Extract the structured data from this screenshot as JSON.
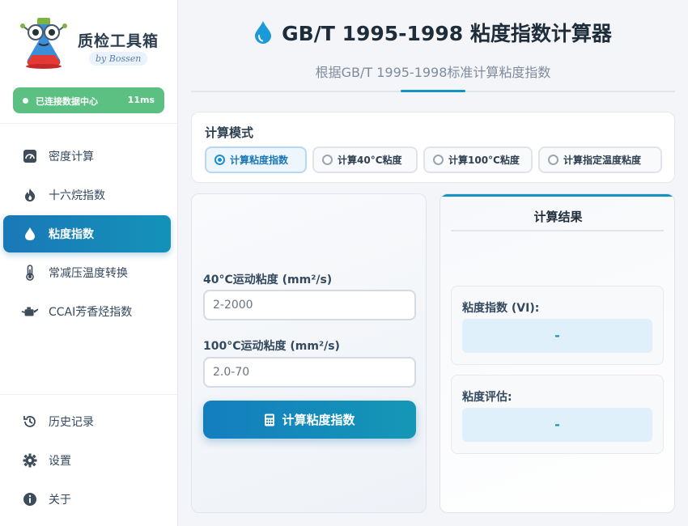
{
  "sidebar": {
    "brand": {
      "title": "质检工具箱",
      "subtitle": "by Bossen"
    },
    "status": {
      "text": "已连接数据中心",
      "latency": "11ms",
      "color": "#5cc083"
    },
    "nav": [
      {
        "label": "密度计算",
        "icon": "gauge-icon"
      },
      {
        "label": "十六烷指数",
        "icon": "fire-icon"
      },
      {
        "label": "粘度指数",
        "icon": "droplet-icon",
        "active": true
      },
      {
        "label": "常减压温度转换",
        "icon": "thermometer-icon"
      },
      {
        "label": "CCAI芳香烃指数",
        "icon": "oil-can-icon"
      }
    ],
    "bottom_nav": [
      {
        "label": "历史记录",
        "icon": "history-icon"
      },
      {
        "label": "设置",
        "icon": "gear-icon"
      },
      {
        "label": "关于",
        "icon": "info-icon"
      }
    ]
  },
  "header": {
    "title": "GB/T 1995-1998 粘度指数计算器",
    "subtitle": "根据GB/T 1995-1998标准计算粘度指数"
  },
  "mode": {
    "label": "计算模式",
    "options": [
      {
        "label": "计算粘度指数",
        "selected": true
      },
      {
        "label": "计算40°C粘度",
        "selected": false
      },
      {
        "label": "计算100°C粘度",
        "selected": false
      },
      {
        "label": "计算指定温度粘度",
        "selected": false
      }
    ]
  },
  "inputs": {
    "v40": {
      "label": "40°C运动粘度 (mm²/s)",
      "placeholder": "2-2000",
      "value": ""
    },
    "v100": {
      "label": "100°C运动粘度 (mm²/s)",
      "placeholder": "2.0-70",
      "value": ""
    },
    "calc_button": "计算粘度指数"
  },
  "result": {
    "title": "计算结果",
    "vi": {
      "label": "粘度指数 (VI):",
      "value": "-"
    },
    "evaluation": {
      "label": "粘度评估:",
      "value": "-"
    }
  },
  "colors": {
    "accent": "#1493c2",
    "status_green": "#5cc083",
    "result_value": "#1597b6"
  }
}
